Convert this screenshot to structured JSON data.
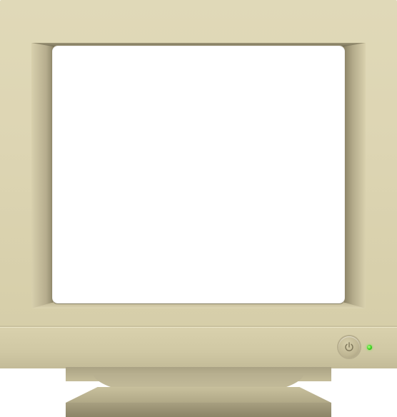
{
  "device": {
    "type": "crt-monitor",
    "power_state": "on",
    "led_color": "#3cd41f",
    "casing_color": "#ddd5b3"
  },
  "icons": {
    "power": "power-icon"
  }
}
